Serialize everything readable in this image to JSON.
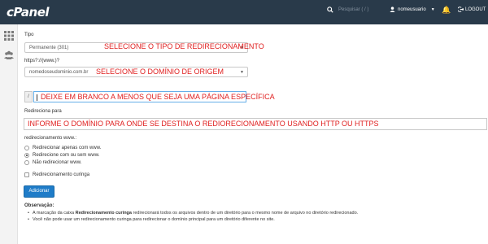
{
  "header": {
    "logo": "cPanel",
    "search_placeholder": "Pesquisar ( / )",
    "username": "nomeusuario",
    "logout_label": "LOGOUT"
  },
  "form": {
    "type_label": "Tipo",
    "type_value": "Permanente (301)",
    "domain_label": "https?://(www.)?",
    "domain_value": "nomedoseudominio.com.br",
    "path_prefix": "/",
    "redirect_label": "Redireciona para",
    "www_label": "redirecionamento www.:",
    "www_options": [
      {
        "label": "Redirecionar apenas com www.",
        "selected": false
      },
      {
        "label": "Redirecione com ou sem www.",
        "selected": true
      },
      {
        "label": "Não redirecionar www.",
        "selected": false
      }
    ],
    "wildcard_label": "Redirecionamento curinga",
    "submit_label": "Adicionar"
  },
  "annotations": {
    "type_note": "SELECIONE O TIPO DE REDIRECIONAMENTO",
    "domain_note": "SELECIONE O DOMÍNIO DE ORIGEM",
    "path_note": "DEIXE EM BRANCO A MENOS QUE SEJA UMA PÁGINA ESPECÍFICA",
    "dest_note": "INFORME O DOMÍNIO PARA ONDE SE DESTINA O REDIORECIONAMENTO USANDO HTTP OU HTTPS"
  },
  "observations": {
    "title": "Observação:",
    "item1_pre": "A marcação da caixa ",
    "item1_bold": "Redirecionamento curinga",
    "item1_post": " redirecionará todos os arquivos dentro de um diretório para o mesmo nome de arquivo no diretório redirecionado.",
    "item2": "Você não pode usar um redirecionamento curinga para redirecionar o domínio principal para um diretório diferente no site."
  },
  "colors": {
    "topbar": "#293a4a",
    "annotation": "#e02020",
    "primary_button": "#1f7cc8"
  }
}
